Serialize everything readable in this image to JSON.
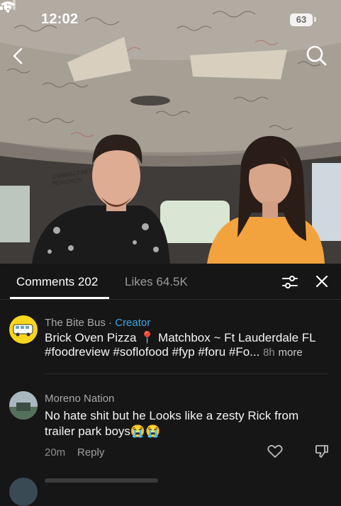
{
  "status_bar": {
    "time": "12:02",
    "battery": "63"
  },
  "nav": {
    "back_icon": "chevron-left-icon",
    "search_icon": "search-icon"
  },
  "video": {
    "van_sign_text": "CONNECT AFTER PERIGNON"
  },
  "comments_panel": {
    "tab_comments": "Comments 202",
    "tab_likes": "Likes 64.5K",
    "filter_icon": "sliders-icon",
    "close_icon": "close-icon",
    "comments": [
      {
        "username": "The Bite Bus",
        "separator": " · ",
        "badge": "Creator",
        "line1": "Brick Oven Pizza  📍 Matchbox ~ Ft Lauderdale FL",
        "line2": "#foodreview #soflofood #fyp #foru #Fo...",
        "time": "8h",
        "more": "more"
      },
      {
        "username": "Moreno Nation",
        "line1": "No hate shit but he Looks like a zesty Rick from",
        "line2": "trailer park boys😭😭",
        "time": "20m",
        "reply": "Reply"
      }
    ]
  },
  "colors": {
    "panel_bg": "#161616",
    "creator_accent": "#3aa8e6",
    "avatar_yellow": "#f7d51c"
  }
}
